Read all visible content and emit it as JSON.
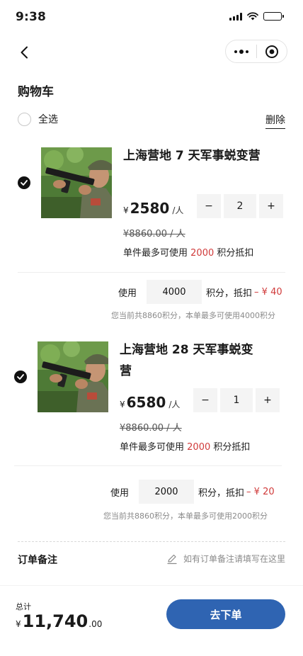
{
  "status_bar": {
    "time": "9:38",
    "icons": [
      "signal-icon",
      "wifi-icon",
      "battery-icon"
    ]
  },
  "nav": {
    "back_icon": "chevron-left-icon",
    "capsule_icons": [
      "more-dots-icon",
      "close-target-icon"
    ]
  },
  "page": {
    "title": "购物车"
  },
  "toolbar": {
    "select_all_label": "全选",
    "delete_label": "删除"
  },
  "items": [
    {
      "selected": true,
      "title": "上海营地 7 天军事蜕变营",
      "currency": "¥",
      "price": "2580",
      "unit": "/人",
      "quantity": "2",
      "minus": "−",
      "plus": "+",
      "original_price": "¥8860.00 / 人",
      "limit_prefix": "单件最多可使用",
      "limit_points": "2000",
      "limit_suffix": "积分抵扣",
      "use_label": "使用",
      "use_value": "4000",
      "use_mid": "积分，抵扣",
      "use_deduct": "– ¥ 40",
      "hint": "您当前共8860积分，本单最多可使用4000积分"
    },
    {
      "selected": true,
      "title": "上海营地 28 天军事蜕变营",
      "currency": "¥",
      "price": "6580",
      "unit": "/人",
      "quantity": "1",
      "minus": "−",
      "plus": "+",
      "original_price": "¥8860.00 / 人",
      "limit_prefix": "单件最多可使用",
      "limit_points": "2000",
      "limit_suffix": "积分抵扣",
      "use_label": "使用",
      "use_value": "2000",
      "use_mid": "积分，抵扣",
      "use_deduct": "– ¥ 20",
      "hint": "您当前共8860积分，本单最多可使用2000积分"
    }
  ],
  "remark": {
    "label": "订单备注",
    "icon": "pencil-icon",
    "placeholder": "如有订单备注请填写在这里"
  },
  "footer": {
    "total_label": "总计",
    "currency": "¥",
    "total_int": "11,740",
    "total_dec": ".00",
    "submit_label": "去下单"
  },
  "colors": {
    "accent": "#2f64b2",
    "price_red": "#d03a3a",
    "muted": "#8a8a8a",
    "input_bg": "#f4f4f4"
  }
}
